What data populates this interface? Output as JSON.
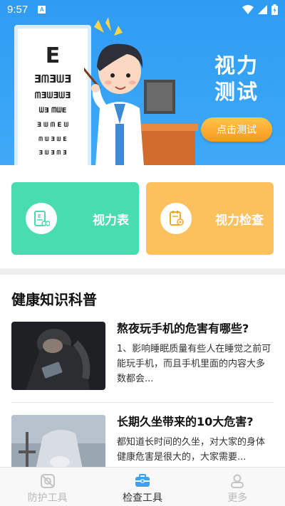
{
  "status_bar": {
    "time": "9:57",
    "app_badge": "A"
  },
  "banner": {
    "eye_chart_rows": [
      "E",
      "ƎᗰƎᗯƎ",
      "ᗰƎᗯƎᗯƎ",
      "ᗯƎ ᗰᗯE",
      "Ǝ ᗯ ᗰ E ᗯ",
      "ᗰ ᗯ Ǝ ᗯ E",
      "Ǝ ᗯ Ǝ ᗰ Ǝ"
    ],
    "title_line1": "视力",
    "title_line2": "测试",
    "test_button": "点击测试"
  },
  "features": [
    {
      "label": "视力表",
      "icon": "eye-chart-icon",
      "color": "#49dcb1"
    },
    {
      "label": "视力检查",
      "icon": "eye-exam-icon",
      "color": "#fcc05d"
    }
  ],
  "section": {
    "title": "健康知识科普"
  },
  "articles": [
    {
      "title": "熬夜玩手机的危害有哪些?",
      "desc": "1、影响睡眠质量有些人在睡觉之前可能玩手机，而且手机里面的内容大多数都会..."
    },
    {
      "title": "长期久坐带来的10大危害?",
      "desc": "都知道长时间的久坐，对大家的身体健康危害是很大的，大家需要..."
    }
  ],
  "bottom_nav": [
    {
      "label": "防护工具",
      "icon": "shield-icon",
      "active": false
    },
    {
      "label": "检查工具",
      "icon": "toolbox-icon",
      "active": true
    },
    {
      "label": "更多",
      "icon": "person-icon",
      "active": false
    }
  ]
}
